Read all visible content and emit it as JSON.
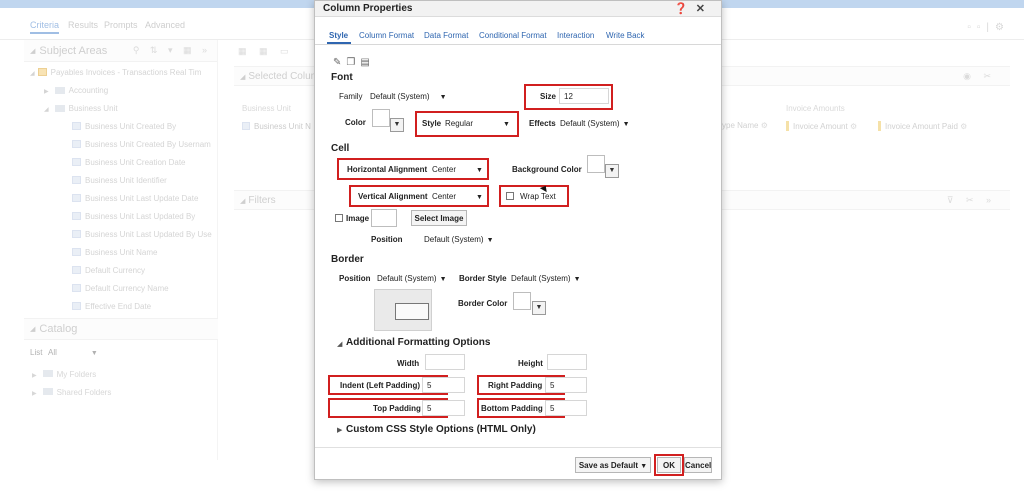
{
  "app": {
    "tabs": [
      "Criteria",
      "Results",
      "Prompts",
      "Advanced"
    ],
    "subject_areas_title": "Subject Areas",
    "tree": [
      {
        "label": "Payables Invoices - Transactions Real Tim",
        "type": "root"
      },
      {
        "label": "Accounting",
        "type": "folder"
      },
      {
        "label": "Business Unit",
        "type": "folder"
      },
      {
        "label": "Business Unit Created By",
        "type": "col"
      },
      {
        "label": "Business Unit Created By Usernam",
        "type": "col"
      },
      {
        "label": "Business Unit Creation Date",
        "type": "col"
      },
      {
        "label": "Business Unit Identifier",
        "type": "col"
      },
      {
        "label": "Business Unit Last Update Date",
        "type": "col"
      },
      {
        "label": "Business Unit Last Updated By",
        "type": "col"
      },
      {
        "label": "Business Unit Last Updated By Use",
        "type": "col"
      },
      {
        "label": "Business Unit Name",
        "type": "col"
      },
      {
        "label": "Default Currency",
        "type": "col"
      },
      {
        "label": "Default Currency Name",
        "type": "col"
      },
      {
        "label": "Effective End Date",
        "type": "col"
      }
    ],
    "catalog_title": "Catalog",
    "catalog_list_label": "List",
    "catalog_list_value": "All",
    "catalog_items": [
      "My Folders",
      "Shared Folders"
    ],
    "selected_columns_title": "Selected Colum",
    "business_unit_group": "Business Unit",
    "business_unit_chip": "Business Unit N",
    "filters_title": "Filters",
    "invoice_amounts_group": "Invoice Amounts",
    "bg_columns": [
      "ype Name",
      "Invoice Amount",
      "Invoice Amount Paid"
    ]
  },
  "dialog": {
    "title": "Column Properties",
    "tabs": [
      "Style",
      "Column Format",
      "Data Format",
      "Conditional Format",
      "Interaction",
      "Write Back"
    ],
    "font": {
      "header": "Font",
      "family_label": "Family",
      "family_value": "Default (System)",
      "size_label": "Size",
      "size_value": "12",
      "color_label": "Color",
      "style_label": "Style",
      "style_value": "Regular",
      "effects_label": "Effects",
      "effects_value": "Default (System)"
    },
    "cell": {
      "header": "Cell",
      "h_align_label": "Horizontal Alignment",
      "h_align_value": "Center",
      "bg_color_label": "Background Color",
      "v_align_label": "Vertical Alignment",
      "v_align_value": "Center",
      "wrap_text_label": "Wrap Text",
      "image_label": "Image",
      "select_image_label": "Select Image",
      "position_label": "Position",
      "position_value": "Default (System)"
    },
    "border": {
      "header": "Border",
      "position_label": "Position",
      "position_value": "Default (System)",
      "style_label": "Border Style",
      "style_value": "Default (System)",
      "color_label": "Border Color"
    },
    "additional": {
      "header": "Additional Formatting Options",
      "width_label": "Width",
      "height_label": "Height",
      "indent_label": "Indent (Left Padding)",
      "indent_value": "5",
      "right_padding_label": "Right Padding",
      "right_padding_value": "5",
      "top_padding_label": "Top Padding",
      "top_padding_value": "5",
      "bottom_padding_label": "Bottom Padding",
      "bottom_padding_value": "5"
    },
    "custom_css_header": "Custom CSS Style Options (HTML Only)",
    "save_default_label": "Save as Default",
    "ok_label": "OK",
    "cancel_label": "Cancel"
  },
  "colors": {
    "highlight": "#d11f1f",
    "link": "#2f66b0"
  }
}
